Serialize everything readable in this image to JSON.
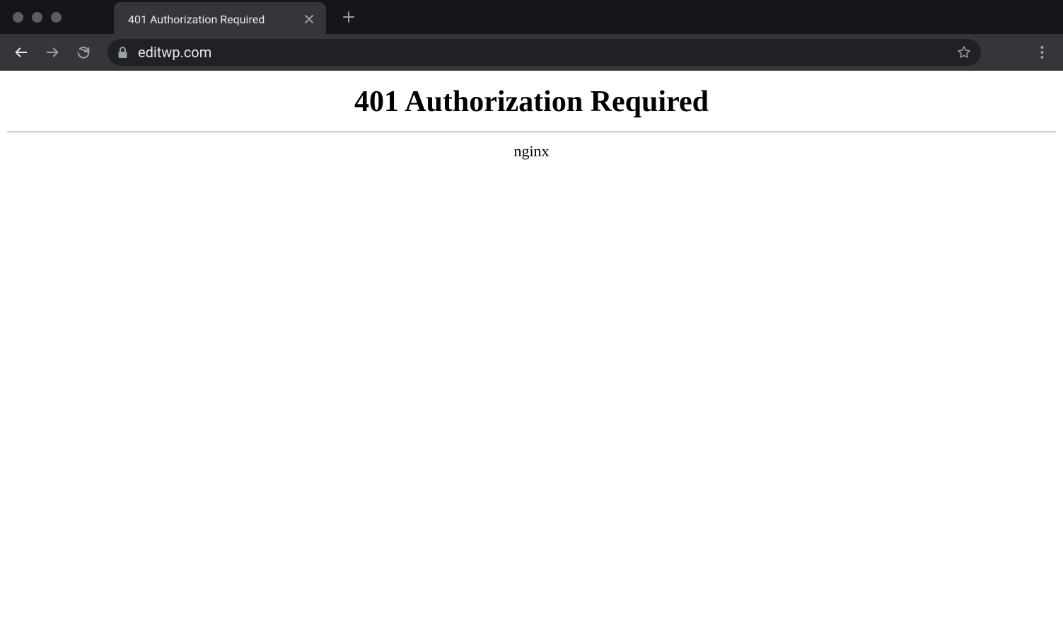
{
  "browser": {
    "tab": {
      "title": "401 Authorization Required"
    },
    "url": "editwp.com"
  },
  "page": {
    "heading": "401 Authorization Required",
    "server": "nginx"
  }
}
